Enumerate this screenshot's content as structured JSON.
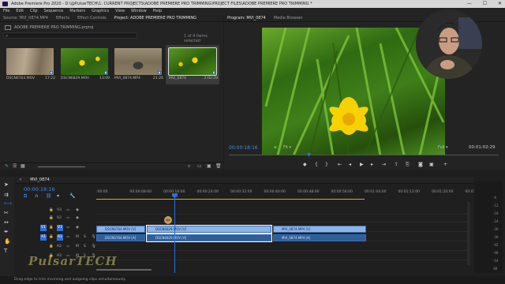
{
  "window": {
    "title": "Adobe Premiere Pro 2020 - D:\\@PulsarTECH\\1. CURRENT PROJECTS\\ADOBE PREMIERE PRO TRIMMING\\PROJECT FILES\\ADOBE PREMIERE PRO TRIMMING *",
    "minimize": "—",
    "maximize": "☐",
    "close": "✕"
  },
  "menu": [
    "File",
    "Edit",
    "Clip",
    "Sequence",
    "Markers",
    "Graphics",
    "View",
    "Window",
    "Help"
  ],
  "source_tabs": [
    "Source: MVI_0874.MP4",
    "Effects",
    "Effect Controls",
    "Project: ADOBE PREMIERE PRO TRIMMING"
  ],
  "project": {
    "filename": "ADOBE PREMIERE PRO TRIMMING.prproj",
    "search_placeholder": "",
    "selected_count": "1 of 4 items selected",
    "items": [
      {
        "name": "DSCN6764.MOV",
        "duration": "17:22"
      },
      {
        "name": "DSCN6829.MOV",
        "duration": "13:09"
      },
      {
        "name": "MVI_0874.MP4",
        "duration": "21:26"
      },
      {
        "name": "MVI_0874",
        "duration": "2:02:29"
      }
    ]
  },
  "program_tabs": [
    "Program: MVI_0874",
    "Media Browser"
  ],
  "program": {
    "timecode": "00:00:18:16",
    "fit": "Fit",
    "full": "Full",
    "duration": "00:01:02:29"
  },
  "timeline": {
    "tab": "MVI_0874",
    "timecode": "00:00:18:16",
    "ruler": [
      ":00:00",
      "00:00:08:00",
      "00:00:16:00",
      "00:00:24:00",
      "00:00:32:00",
      "00:00:40:00",
      "00:00:48:00",
      "00:00:56:00",
      "00:01:04:00",
      "00:01:12:00",
      "00:01:20:00",
      "00:01:28:00"
    ],
    "tracks": [
      {
        "name": "V3",
        "type": "video"
      },
      {
        "name": "V2",
        "type": "video"
      },
      {
        "name": "V1",
        "type": "video",
        "src": "V1"
      },
      {
        "name": "A1",
        "type": "audio",
        "src": "A1"
      },
      {
        "name": "A2",
        "type": "audio"
      },
      {
        "name": "A3",
        "type": "audio"
      }
    ],
    "video_clips": [
      "DSCN6764.MOV [V]",
      "DSCN6829.MOV [V]",
      "MVI_0874.MP4 [V]"
    ],
    "audio_clips": [
      "DSCN6764.MOV [A]",
      "DSCN6829.MOV [A]",
      "MVI_0874.MP4 [A]"
    ],
    "meter_labels": [
      "-6",
      "-12",
      "-18",
      "-24",
      "-30",
      "-36",
      "-42",
      "-48",
      "-54",
      "dB"
    ]
  },
  "status": "Drag edge to trim incoming and outgoing clips simultaneously.",
  "watermark": "PulsarTECH",
  "colors": {
    "clip_video": "#8db4e8",
    "clip_audio": "#2f5f97",
    "playhead": "#2d6fd6",
    "accent_blue": "#2d6fd6"
  }
}
